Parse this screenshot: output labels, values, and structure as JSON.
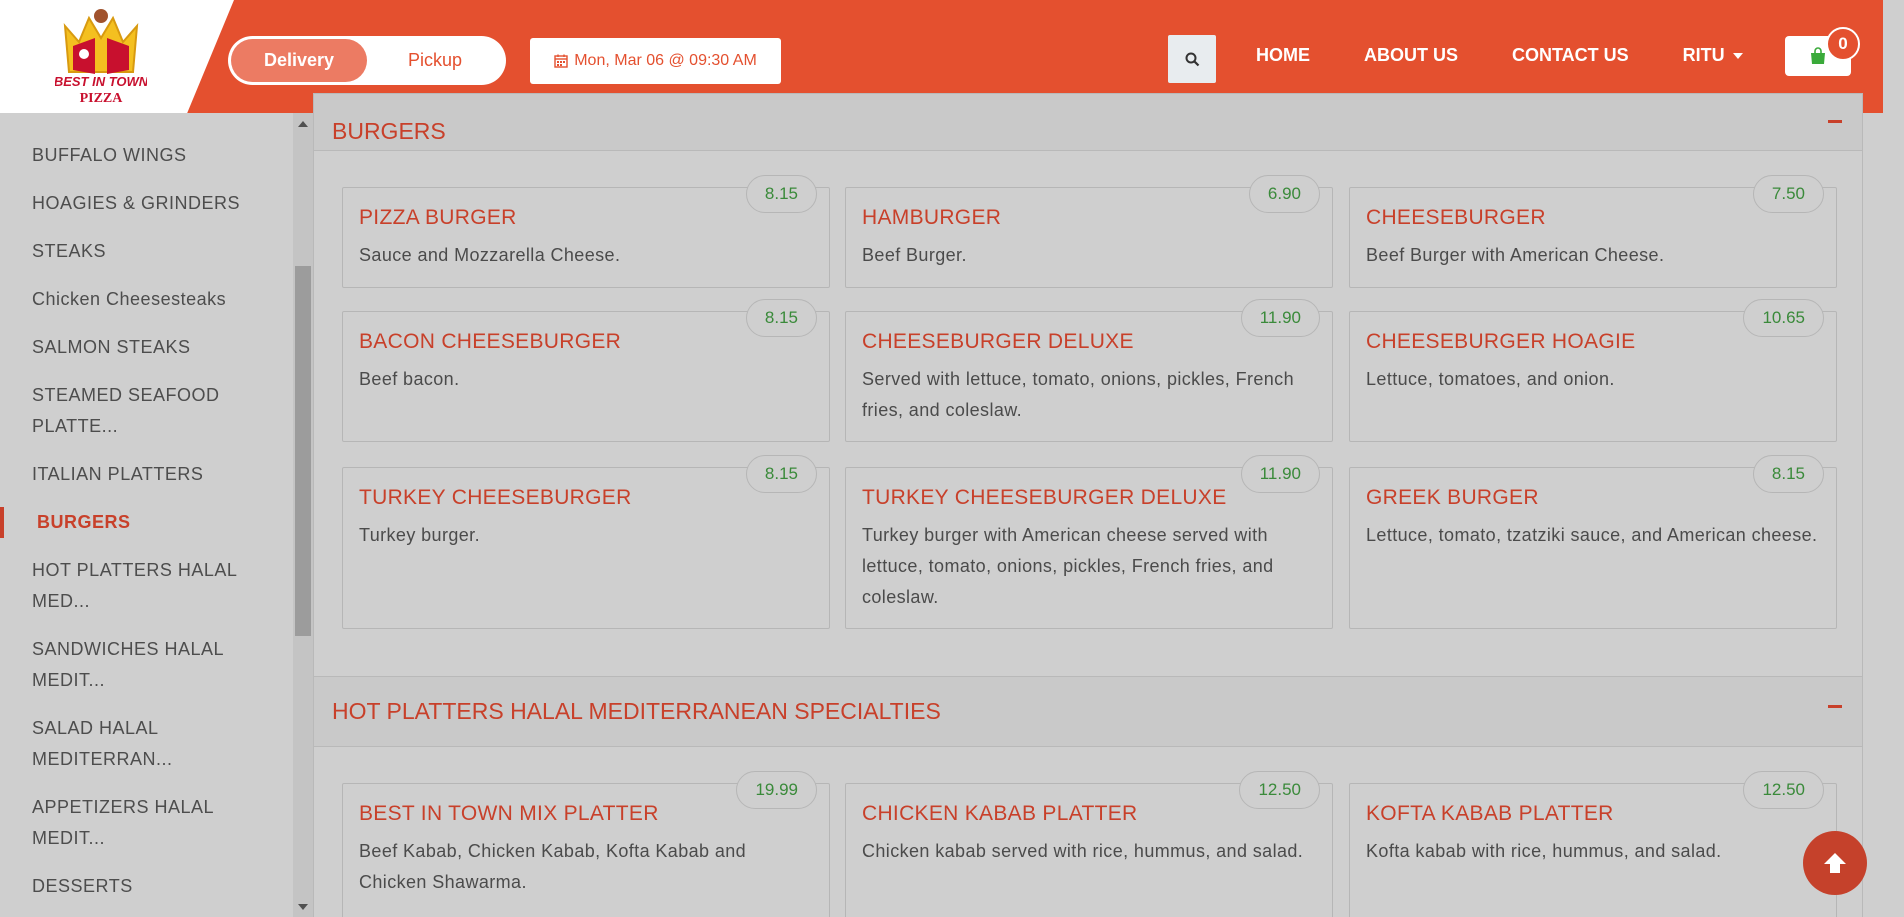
{
  "brand": {
    "logo_lines": [
      "BEST IN TOWN",
      "PIZZA"
    ]
  },
  "order_mode": {
    "options": [
      "Delivery",
      "Pickup"
    ],
    "selected": "Delivery"
  },
  "schedule": {
    "label": "Mon, Mar 06 @ 09:30 AM"
  },
  "nav": {
    "items": [
      "HOME",
      "ABOUT US",
      "CONTACT US",
      "RITU"
    ]
  },
  "cart": {
    "count": "0"
  },
  "sidebar": {
    "items": [
      "BUFFALO WINGS",
      "HOAGIES & GRINDERS",
      "STEAKS",
      "Chicken Cheesesteaks",
      "SALMON STEAKS",
      "STEAMED SEAFOOD PLATTE...",
      "ITALIAN PLATTERS",
      "BURGERS",
      "HOT PLATTERS HALAL MED...",
      "SANDWICHES HALAL MEDIT...",
      "SALAD HALAL MEDITERRAN...",
      "APPETIZERS HALAL MEDIT...",
      "DESSERTS"
    ],
    "active": "BURGERS"
  },
  "sections": [
    {
      "title": "BURGERS",
      "items": [
        {
          "name": "PIZZA BURGER",
          "desc": "Sauce and Mozzarella Cheese.",
          "price": "8.15"
        },
        {
          "name": "HAMBURGER",
          "desc": "Beef Burger.",
          "price": "6.90"
        },
        {
          "name": "CHEESEBURGER",
          "desc": "Beef Burger with American Cheese.",
          "price": "7.50"
        },
        {
          "name": "BACON CHEESEBURGER",
          "desc": "Beef bacon.",
          "price": "8.15"
        },
        {
          "name": "CHEESEBURGER DELUXE",
          "desc": "Served with lettuce, tomato, onions, pickles, French fries, and coleslaw.",
          "price": "11.90"
        },
        {
          "name": "CHEESEBURGER HOAGIE",
          "desc": "Lettuce, tomatoes, and onion.",
          "price": "10.65"
        },
        {
          "name": "TURKEY CHEESEBURGER",
          "desc": "Turkey burger.",
          "price": "8.15"
        },
        {
          "name": "TURKEY CHEESEBURGER DELUXE",
          "desc": "Turkey burger with American cheese served with lettuce, tomato, onions, pickles, French fries, and coleslaw.",
          "price": "11.90"
        },
        {
          "name": "GREEK BURGER",
          "desc": "Lettuce, tomato, tzatziki sauce, and American cheese.",
          "price": "8.15"
        }
      ]
    },
    {
      "title": "HOT PLATTERS HALAL MEDITERRANEAN SPECIALTIES",
      "items": [
        {
          "name": "BEST IN TOWN MIX PLATTER",
          "desc": "Beef Kabab, Chicken Kabab, Kofta Kabab and Chicken Shawarma.",
          "price": "19.99"
        },
        {
          "name": "CHICKEN KABAB PLATTER",
          "desc": "Chicken kabab served with rice, hummus, and salad.",
          "price": "12.50"
        },
        {
          "name": "KOFTA KABAB PLATTER",
          "desc": "Kofta kabab with rice, hummus, and salad.",
          "price": "12.50"
        }
      ]
    }
  ],
  "colors": {
    "brand": "#e4502f",
    "title_red": "#c8402a",
    "price_green": "#3a8a3a",
    "overlay_gray": "#cfcfcf"
  }
}
